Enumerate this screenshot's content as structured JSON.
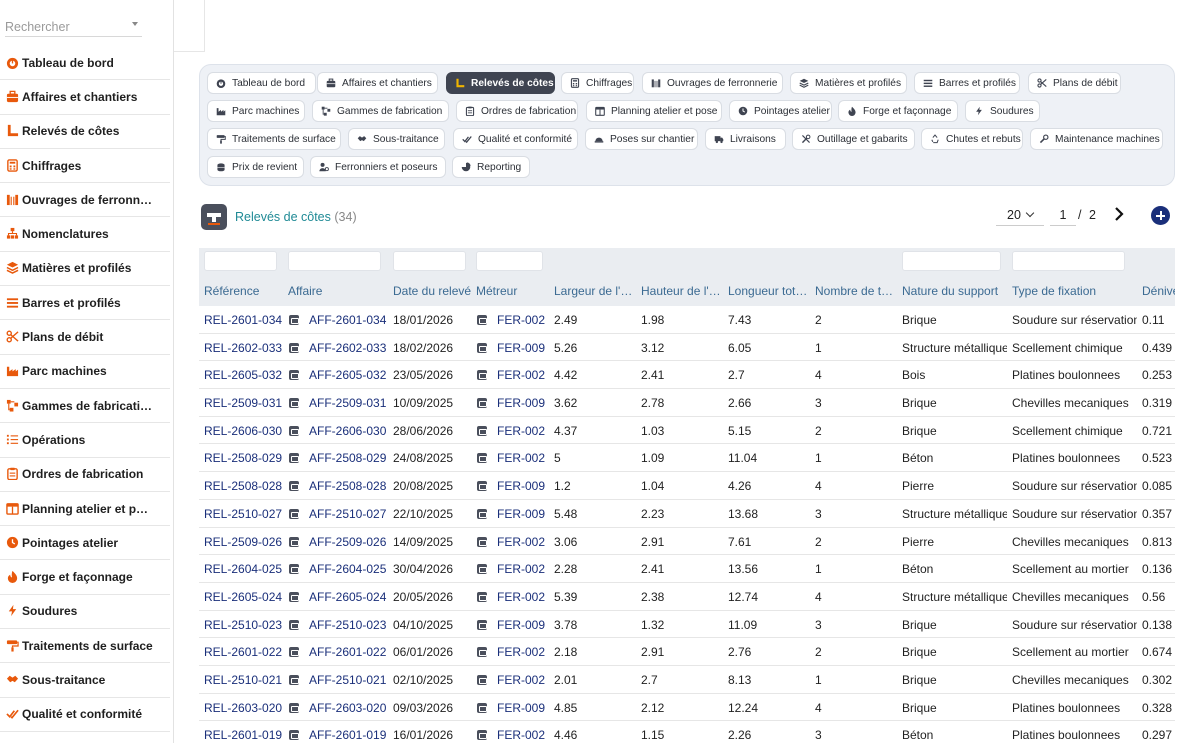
{
  "search": {
    "placeholder": "Rechercher"
  },
  "colors": {
    "accent": "#e8590c",
    "teal": "#1f8a95",
    "navy": "#1a2f7a",
    "dark": "#3f4451"
  },
  "sidebar": {
    "items": [
      {
        "label": "Tableau de bord",
        "icon": "dashboard-icon"
      },
      {
        "label": "Affaires et chantiers",
        "icon": "briefcase-icon"
      },
      {
        "label": "Relevés de côtes",
        "icon": "ruler-icon"
      },
      {
        "label": "Chiffrages",
        "icon": "calculator-icon"
      },
      {
        "label": "Ouvrages de ferronn…",
        "icon": "gate-icon"
      },
      {
        "label": "Nomenclatures",
        "icon": "sitemap-icon"
      },
      {
        "label": "Matières et profilés",
        "icon": "layers-icon"
      },
      {
        "label": "Barres et profilés",
        "icon": "bars-icon"
      },
      {
        "label": "Plans de débit",
        "icon": "scissors-icon"
      },
      {
        "label": "Parc machines",
        "icon": "industry-icon"
      },
      {
        "label": "Gammes de fabricati…",
        "icon": "diagram-icon"
      },
      {
        "label": "Opérations",
        "icon": "list-icon"
      },
      {
        "label": "Ordres de fabrication",
        "icon": "clipboard-icon"
      },
      {
        "label": "Planning atelier et p…",
        "icon": "calendar-icon"
      },
      {
        "label": "Pointages atelier",
        "icon": "clock-icon"
      },
      {
        "label": "Forge et façonnage",
        "icon": "fire-icon"
      },
      {
        "label": "Soudures",
        "icon": "bolt-icon"
      },
      {
        "label": "Traitements de surface",
        "icon": "paint-roller-icon"
      },
      {
        "label": "Sous-traitance",
        "icon": "handshake-icon"
      },
      {
        "label": "Qualité et conformité",
        "icon": "check-double-icon"
      }
    ]
  },
  "modules": [
    {
      "label": "Tableau de bord",
      "icon": "dashboard-icon",
      "active": false
    },
    {
      "label": "Affaires et chantiers",
      "icon": "briefcase-icon",
      "active": false
    },
    {
      "label": "Relevés de côtes",
      "icon": "ruler-icon",
      "active": true
    },
    {
      "label": "Chiffrages",
      "icon": "calculator-icon",
      "active": false
    },
    {
      "label": "Ouvrages de ferronnerie",
      "icon": "gate-icon",
      "active": false
    },
    {
      "label": "Matières et profilés",
      "icon": "layers-icon",
      "active": false
    },
    {
      "label": "Barres et profilés",
      "icon": "bars-icon",
      "active": false
    },
    {
      "label": "Plans de débit",
      "icon": "scissors-icon",
      "active": false
    },
    {
      "label": "Parc machines",
      "icon": "industry-icon",
      "active": false
    },
    {
      "label": "Gammes de fabrication",
      "icon": "diagram-icon",
      "active": false
    },
    {
      "label": "Ordres de fabrication",
      "icon": "clipboard-icon",
      "active": false
    },
    {
      "label": "Planning atelier et pose",
      "icon": "calendar-icon",
      "active": false
    },
    {
      "label": "Pointages atelier",
      "icon": "clock-icon",
      "active": false
    },
    {
      "label": "Forge et façonnage",
      "icon": "fire-icon",
      "active": false
    },
    {
      "label": "Soudures",
      "icon": "bolt-icon",
      "active": false
    },
    {
      "label": "Traitements de surface",
      "icon": "paint-roller-icon",
      "active": false
    },
    {
      "label": "Sous-traitance",
      "icon": "handshake-icon",
      "active": false
    },
    {
      "label": "Qualité et conformité",
      "icon": "check-double-icon",
      "active": false
    },
    {
      "label": "Poses sur chantier",
      "icon": "helmet-icon",
      "active": false
    },
    {
      "label": "Livraisons",
      "icon": "truck-icon",
      "active": false
    },
    {
      "label": "Outillage et gabarits",
      "icon": "tools-icon",
      "active": false
    },
    {
      "label": "Chutes et rebuts",
      "icon": "recycle-icon",
      "active": false
    },
    {
      "label": "Maintenance machines",
      "icon": "wrench-icon",
      "active": false
    },
    {
      "label": "Prix de revient",
      "icon": "coins-icon",
      "active": false
    },
    {
      "label": "Ferronniers et poseurs",
      "icon": "user-gear-icon",
      "active": false
    },
    {
      "label": "Reporting",
      "icon": "chart-pie-icon",
      "active": false
    }
  ],
  "list": {
    "title": "Relevés de côtes",
    "count": "(34)",
    "page_size": "20",
    "page_current": "1",
    "page_sep": "/",
    "page_total": "2"
  },
  "table": {
    "columns": [
      "Référence",
      "Affaire",
      "Date du relevé",
      "Métreur",
      "Largeur de l'…",
      "Hauteur de l'…",
      "Longueur tot…",
      "Nombre de t…",
      "Nature du support",
      "Type de fixation",
      "Dénive"
    ],
    "rows": [
      [
        "REL-2601-034",
        "AFF-2601-034",
        "18/01/2026",
        "FER-002",
        "2.49",
        "1.98",
        "7.43",
        "2",
        "Brique",
        "Soudure sur réservation",
        "0.11"
      ],
      [
        "REL-2602-033",
        "AFF-2602-033",
        "18/02/2026",
        "FER-009",
        "5.26",
        "3.12",
        "6.05",
        "1",
        "Structure métallique",
        "Scellement chimique",
        "0.439"
      ],
      [
        "REL-2605-032",
        "AFF-2605-032",
        "23/05/2026",
        "FER-002",
        "4.42",
        "2.41",
        "2.7",
        "4",
        "Bois",
        "Platines boulonnees",
        "0.253"
      ],
      [
        "REL-2509-031",
        "AFF-2509-031",
        "10/09/2025",
        "FER-009",
        "3.62",
        "2.78",
        "2.66",
        "3",
        "Brique",
        "Chevilles mecaniques",
        "0.319"
      ],
      [
        "REL-2606-030",
        "AFF-2606-030",
        "28/06/2026",
        "FER-002",
        "4.37",
        "1.03",
        "5.15",
        "2",
        "Brique",
        "Scellement chimique",
        "0.721"
      ],
      [
        "REL-2508-029",
        "AFF-2508-029",
        "24/08/2025",
        "FER-002",
        "5",
        "1.09",
        "11.04",
        "1",
        "Béton",
        "Platines boulonnees",
        "0.523"
      ],
      [
        "REL-2508-028",
        "AFF-2508-028",
        "20/08/2025",
        "FER-009",
        "1.2",
        "1.04",
        "4.26",
        "4",
        "Pierre",
        "Soudure sur réservation",
        "0.085"
      ],
      [
        "REL-2510-027",
        "AFF-2510-027",
        "22/10/2025",
        "FER-009",
        "5.48",
        "2.23",
        "13.68",
        "3",
        "Structure métallique",
        "Soudure sur réservation",
        "0.357"
      ],
      [
        "REL-2509-026",
        "AFF-2509-026",
        "14/09/2025",
        "FER-002",
        "3.06",
        "2.91",
        "7.61",
        "2",
        "Pierre",
        "Chevilles mecaniques",
        "0.813"
      ],
      [
        "REL-2604-025",
        "AFF-2604-025",
        "30/04/2026",
        "FER-002",
        "2.28",
        "2.41",
        "13.56",
        "1",
        "Béton",
        "Scellement au mortier",
        "0.136"
      ],
      [
        "REL-2605-024",
        "AFF-2605-024",
        "20/05/2026",
        "FER-002",
        "5.39",
        "2.38",
        "12.74",
        "4",
        "Structure métallique",
        "Chevilles mecaniques",
        "0.56"
      ],
      [
        "REL-2510-023",
        "AFF-2510-023",
        "04/10/2025",
        "FER-009",
        "3.78",
        "1.32",
        "11.09",
        "3",
        "Brique",
        "Soudure sur réservation",
        "0.138"
      ],
      [
        "REL-2601-022",
        "AFF-2601-022",
        "06/01/2026",
        "FER-002",
        "2.18",
        "2.91",
        "2.76",
        "2",
        "Brique",
        "Scellement au mortier",
        "0.674"
      ],
      [
        "REL-2510-021",
        "AFF-2510-021",
        "02/10/2025",
        "FER-002",
        "2.01",
        "2.7",
        "8.13",
        "1",
        "Brique",
        "Chevilles mecaniques",
        "0.302"
      ],
      [
        "REL-2603-020",
        "AFF-2603-020",
        "09/03/2026",
        "FER-009",
        "4.85",
        "2.12",
        "12.24",
        "4",
        "Brique",
        "Platines boulonnees",
        "0.328"
      ],
      [
        "REL-2601-019",
        "AFF-2601-019",
        "16/01/2026",
        "FER-002",
        "4.46",
        "1.15",
        "2.26",
        "3",
        "Béton",
        "Platines boulonnees",
        "0.297"
      ]
    ]
  }
}
